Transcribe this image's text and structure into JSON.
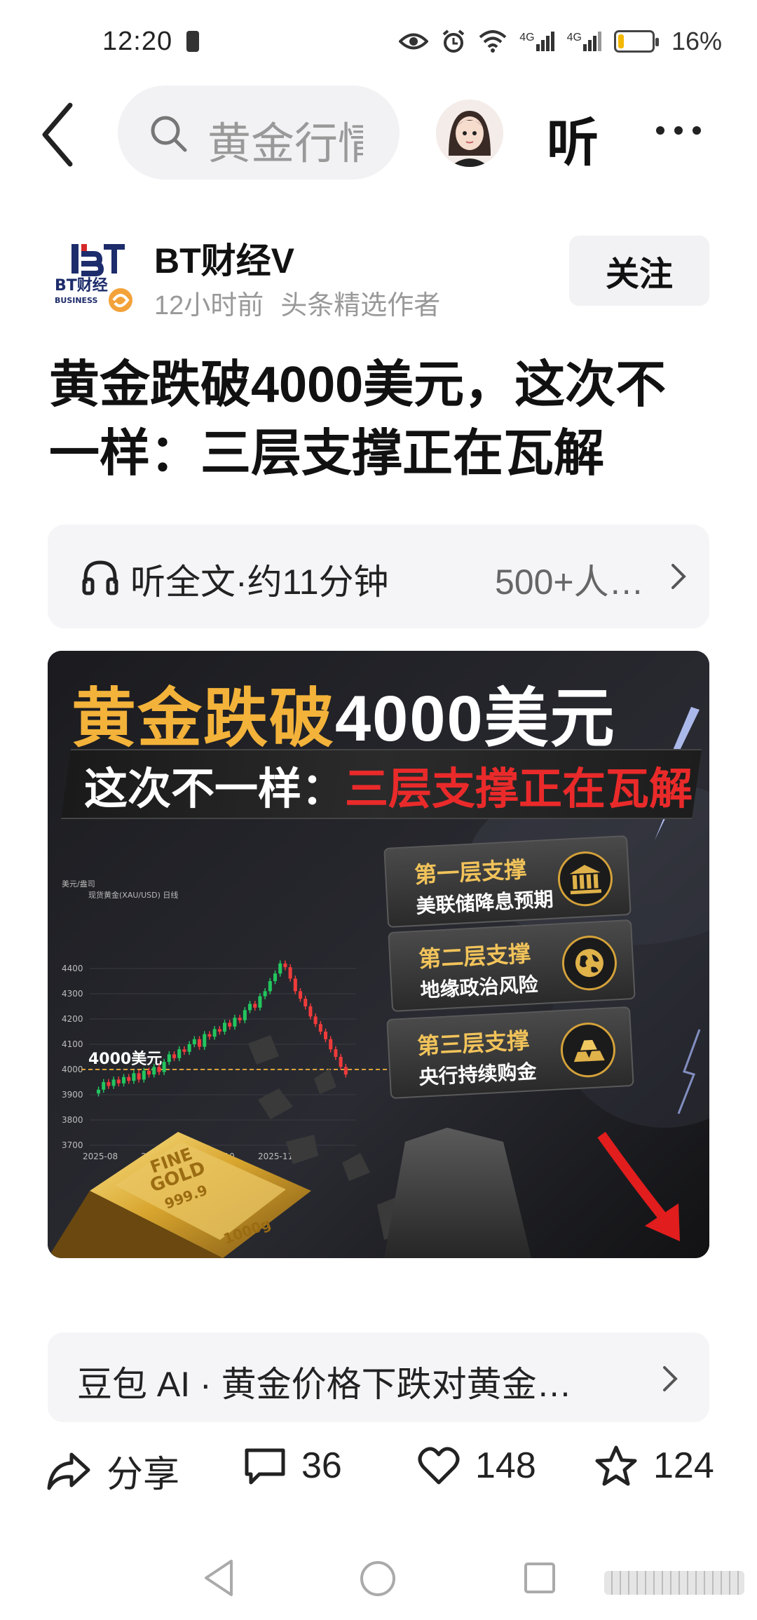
{
  "status_bar": {
    "time": "12:20",
    "network_1": "4G",
    "network_2": "4G",
    "battery_percent": "16%",
    "battery_level": 0.16,
    "battery_color": "#f5b800"
  },
  "top_nav": {
    "search_text": "黄金行情",
    "listen_label": "听",
    "icons": [
      "back-arrow-icon",
      "search-icon",
      "avatar",
      "more-icon"
    ]
  },
  "author": {
    "logo_text": "BT财经",
    "logo_sub": "BUSINESS",
    "name": "BT财经V",
    "time_ago": "12小时前",
    "badge": "头条精选作者",
    "follow_label": "关注"
  },
  "article": {
    "title": "黄金跌破4000美元，这次不一样：三层支撑正在瓦解"
  },
  "listen_bar": {
    "label": "听全文·约11分钟",
    "listeners": "500+人…"
  },
  "cover": {
    "headline_gold": "黄金跌破",
    "headline_white": "4000美元",
    "sub_white": "这次不一样：",
    "sub_red": "三层支撑正在瓦解",
    "chart_title": "现货黄金(XAU/USD)  日线",
    "y_unit": "美元/盎司",
    "level_label": "4000美元",
    "supports": [
      {
        "title": "第一层支撑",
        "subtitle": "美联储降息预期",
        "icon": "bank-icon"
      },
      {
        "title": "第二层支撑",
        "subtitle": "地缘政治风险",
        "icon": "globe-icon"
      },
      {
        "title": "第三层支撑",
        "subtitle": "央行持续购金",
        "icon": "gold-bars-icon"
      }
    ],
    "gold_bar_text": [
      "FINE",
      "GOLD",
      "999.9",
      "1000g"
    ]
  },
  "chart_data": {
    "type": "candlestick",
    "title": "现货黄金(XAU/USD)  日线",
    "ylabel": "美元/盎司",
    "ylim": [
      3700,
      4450
    ],
    "yticks": [
      3700,
      3800,
      3900,
      4000,
      4100,
      4200,
      4300,
      4400
    ],
    "xticks": [
      "2025-08",
      "2025-09",
      "2025-10",
      "2025-11"
    ],
    "reference_line": {
      "value": 4000,
      "label": "4000美元"
    },
    "close_series": [
      3920,
      3950,
      3935,
      3960,
      3945,
      3970,
      3955,
      3985,
      3960,
      3995,
      3980,
      4010,
      3990,
      4030,
      4060,
      4045,
      4080,
      4070,
      4100,
      4120,
      4090,
      4140,
      4130,
      4160,
      4150,
      4185,
      4170,
      4205,
      4195,
      4235,
      4260,
      4245,
      4290,
      4310,
      4350,
      4380,
      4420,
      4405,
      4360,
      4310,
      4280,
      4250,
      4210,
      4180,
      4150,
      4120,
      4080,
      4050,
      4010,
      3980
    ]
  },
  "ai_bar": {
    "text": "豆包 AI · 黄金价格下跌对黄金…"
  },
  "actions": {
    "share_label": "分享",
    "comments": "36",
    "likes": "148",
    "favorites": "124"
  }
}
